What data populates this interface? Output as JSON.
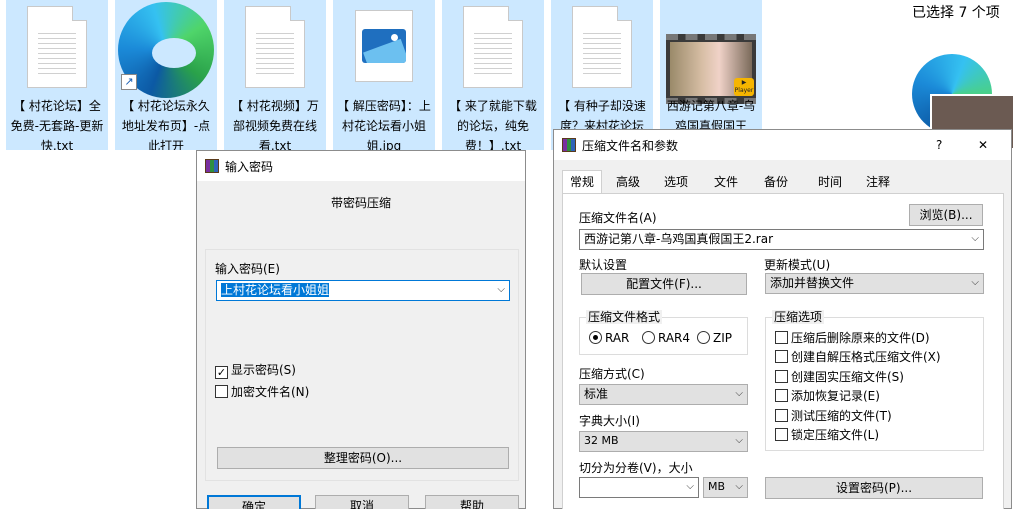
{
  "explorer": {
    "selected_count": "已选择 7 个项",
    "files": [
      {
        "name": "【 村花论坛】全免费-无套路-更新快.txt",
        "kind": "text"
      },
      {
        "name": "【 村花论坛永久地址发布页】-点此打开",
        "kind": "edge-shortcut"
      },
      {
        "name": "【 村花视频】万部视频免费在线看.txt",
        "kind": "text"
      },
      {
        "name": "【 解压密码】：上村花论坛看小姐姐.jpg",
        "kind": "image"
      },
      {
        "name": "【 来了就能下载的论坛，纯免费！】.txt",
        "kind": "text"
      },
      {
        "name": "【 有种子却没速度？来村花论坛",
        "kind": "text"
      },
      {
        "name": "西游记第八章-乌鸡国真假国王",
        "kind": "video"
      }
    ],
    "player_badge": "Player"
  },
  "password_dialog": {
    "title": "输入密码",
    "heading": "带密码压缩",
    "password_label": "输入密码(E)",
    "password_value": "上村花论坛看小姐姐",
    "show_password": {
      "label": "显示密码(S)",
      "checked": true
    },
    "encrypt_names": {
      "label": "加密文件名(N)",
      "checked": false
    },
    "organize_button": "整理密码(O)...",
    "ok_button": "确定",
    "cancel_button": "取消",
    "help_button": "帮助"
  },
  "archive_dialog": {
    "title": "压缩文件名和参数",
    "help_glyph": "?",
    "close_glyph": "✕",
    "tabs": [
      "常规",
      "高级",
      "选项",
      "文件",
      "备份",
      "时间",
      "注释"
    ],
    "active_tab": "常规",
    "archive_name_label": "压缩文件名(A)",
    "browse_button": "浏览(B)...",
    "archive_name_value": "西游记第八章-乌鸡国真假国王2.rar",
    "default_settings_label": "默认设置",
    "profiles_button": "配置文件(F)...",
    "update_mode_label": "更新模式(U)",
    "update_mode_value": "添加并替换文件",
    "format_group": "压缩文件格式",
    "formats": [
      {
        "label": "RAR",
        "selected": true
      },
      {
        "label": "RAR4",
        "selected": false
      },
      {
        "label": "ZIP",
        "selected": false
      }
    ],
    "options_group": "压缩选项",
    "options": [
      {
        "label": "压缩后删除原来的文件(D)",
        "checked": false
      },
      {
        "label": "创建自解压格式压缩文件(X)",
        "checked": false
      },
      {
        "label": "创建固实压缩文件(S)",
        "checked": false
      },
      {
        "label": "添加恢复记录(E)",
        "checked": false
      },
      {
        "label": "测试压缩的文件(T)",
        "checked": false
      },
      {
        "label": "锁定压缩文件(L)",
        "checked": false
      }
    ],
    "method_label": "压缩方式(C)",
    "method_value": "标准",
    "dict_label": "字典大小(I)",
    "dict_value": "32 MB",
    "split_label": "切分为分卷(V)，大小",
    "split_value": "",
    "split_unit": "MB",
    "set_password_button": "设置密码(P)..."
  },
  "colors": {
    "selection": "#cce8ff",
    "dialog_bg": "#f0f0f0",
    "text_highlight": "#0078d7"
  }
}
